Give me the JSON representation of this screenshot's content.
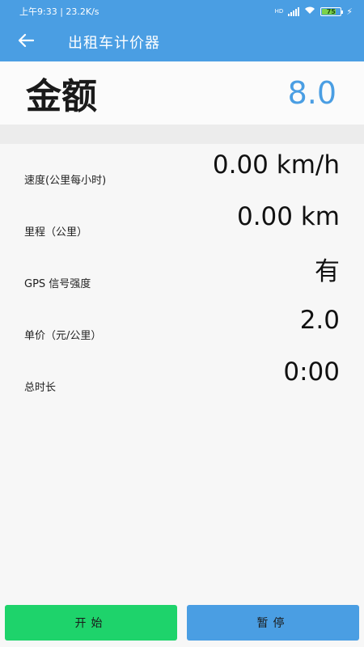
{
  "status_bar": {
    "time_speed": "上午9:33 | 23.2K/s",
    "network_badge": "HD",
    "battery": "75"
  },
  "toolbar": {
    "back_icon": "arrow-left-icon",
    "title": "出租车计价器"
  },
  "amount": {
    "label": "金额",
    "value": "8.0"
  },
  "metrics": [
    {
      "label": "速度(公里每小时)",
      "value": "0.00 km/h"
    },
    {
      "label": "里程（公里）",
      "value": "0.00 km"
    },
    {
      "label": "GPS 信号强度",
      "value": "有"
    },
    {
      "label": "单价（元/公里）",
      "value": "2.0"
    },
    {
      "label": "总时长",
      "value": "0:00"
    }
  ],
  "buttons": {
    "start": "开始",
    "pause": "暂停"
  },
  "colors": {
    "primary": "#4a9ee3",
    "start": "#1ed36b"
  }
}
